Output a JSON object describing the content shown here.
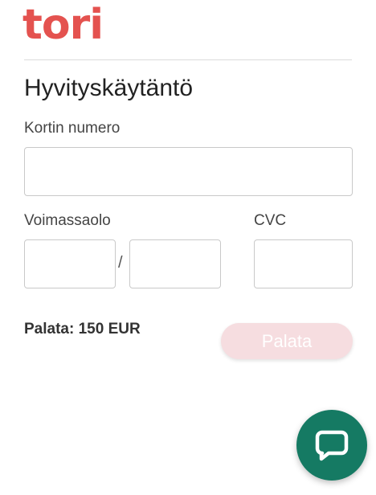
{
  "brand": {
    "logo_text": "tori",
    "color": "#e4524f"
  },
  "form": {
    "title": "Hyvityskäytäntö",
    "card_number_label": "Kortin numero",
    "card_number_value": "",
    "expiry_label": "Voimassaolo",
    "expiry_month_value": "",
    "expiry_separator": "/",
    "expiry_year_value": "",
    "cvc_label": "CVC",
    "cvc_value": "",
    "amount_text": "Palata: 150 EUR",
    "submit_label": "Palata",
    "submit_color": "#f6dde0"
  },
  "chat": {
    "icon": "chat-bubble-icon",
    "color": "#157a63"
  }
}
